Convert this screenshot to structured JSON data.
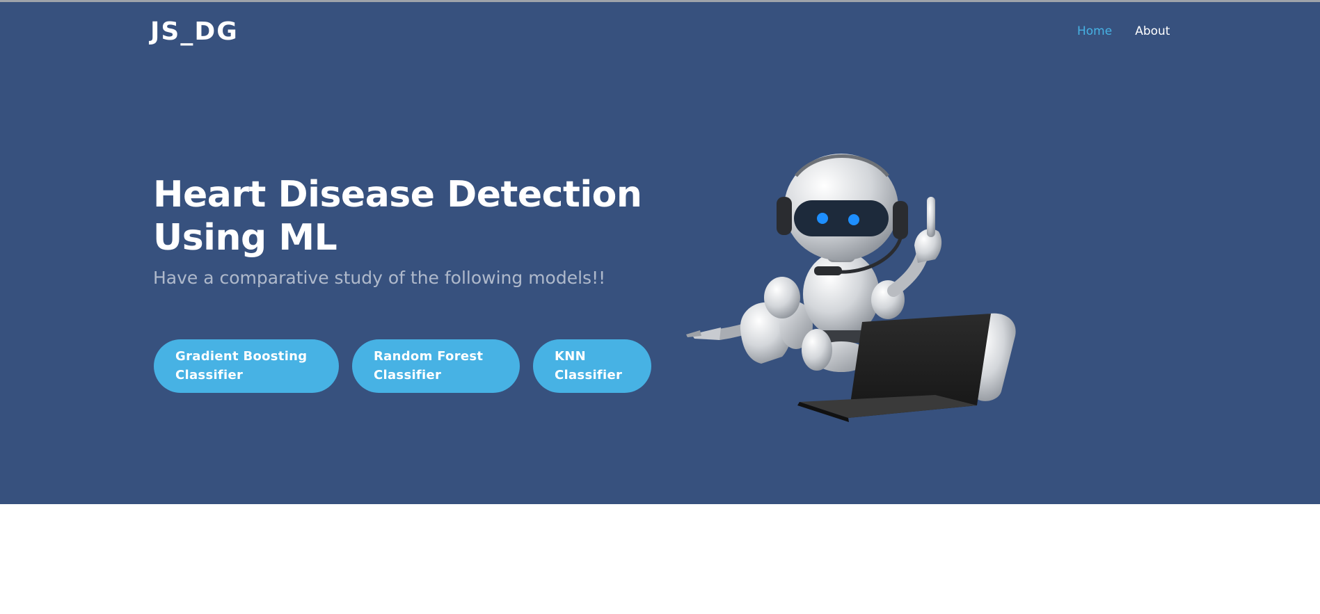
{
  "header": {
    "logo": "JS_DG",
    "nav": [
      {
        "label": "Home",
        "active": true
      },
      {
        "label": "About",
        "active": false
      }
    ]
  },
  "hero": {
    "title_line1": "Heart Disease Detection",
    "title_line2": "Using ML",
    "subtitle": "Have a comparative study of the following models!!",
    "buttons": [
      {
        "line1": "Gradient Boosting",
        "line2": "Classifier"
      },
      {
        "line1": "Random Forest",
        "line2": "Classifier"
      },
      {
        "line1": "KNN",
        "line2": "Classifier"
      }
    ],
    "illustration_icon": "robot-with-laptop-icon"
  },
  "colors": {
    "hero_background": "#37517e",
    "accent": "#47b2e4",
    "text": "#ffffff"
  }
}
